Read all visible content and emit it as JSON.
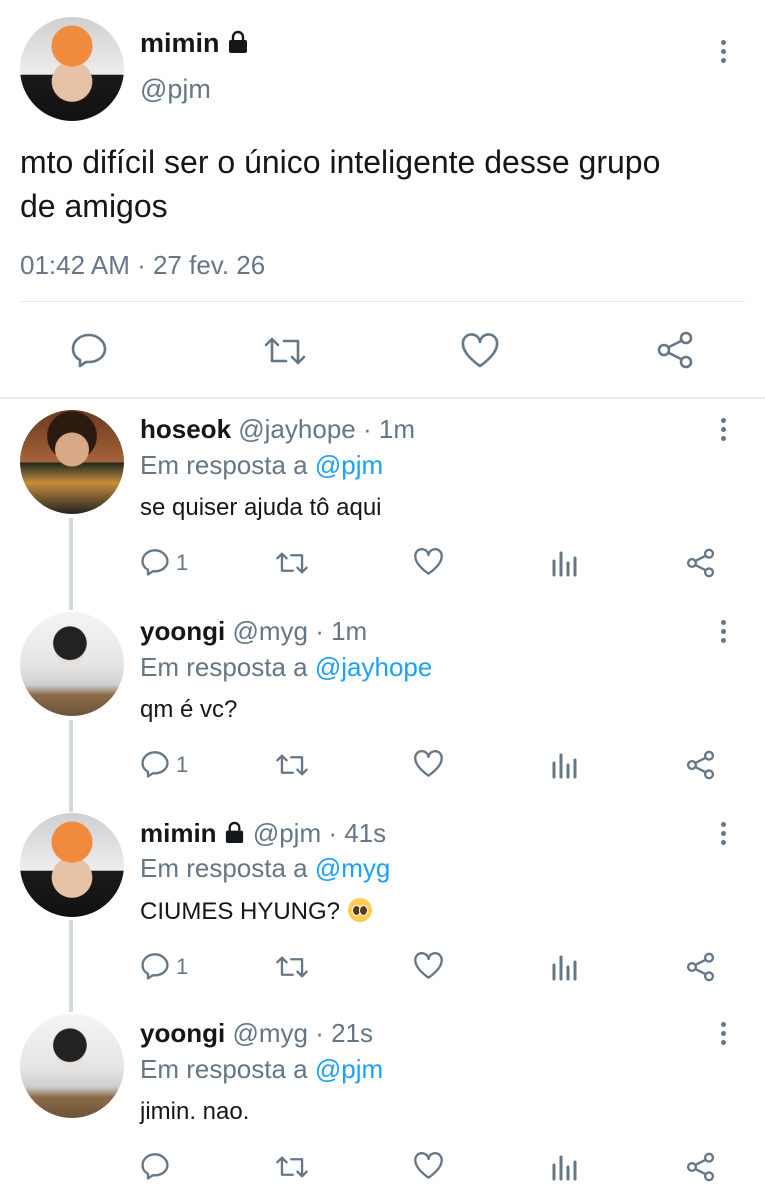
{
  "main_tweet": {
    "display_name": "mimin",
    "handle": "@pjm",
    "text_line1": "mto difícil ser o único inteligente desse grupo",
    "text_line2": "de amigos",
    "time": "01:42 AM · 27 fev. 26"
  },
  "reply_prefix": "Em resposta a",
  "replies": [
    {
      "name": "hoseok",
      "handle": "@jayhope",
      "time": "· 1m",
      "reply_to": "@pjm",
      "text": "se quiser ajuda tô aqui",
      "reply_count": "1"
    },
    {
      "name": "yoongi",
      "handle": "@myg",
      "time": "· 1m",
      "reply_to": "@jayhope",
      "text": "qm é vc?",
      "reply_count": "1"
    },
    {
      "name": "mimin",
      "handle": "@pjm",
      "time": "· 41s",
      "reply_to": "@myg",
      "text": "CIUMES HYUNG?",
      "reply_count": "1"
    },
    {
      "name": "yoongi",
      "handle": "@myg",
      "time": "· 21s",
      "reply_to": "@pjm",
      "text": "jimin. nao.",
      "reply_count": ""
    }
  ],
  "colors": {
    "link_blue": "#1da1f2",
    "muted_gray": "#657786",
    "text_dark": "#14171a",
    "divider": "#e1e8ed"
  }
}
